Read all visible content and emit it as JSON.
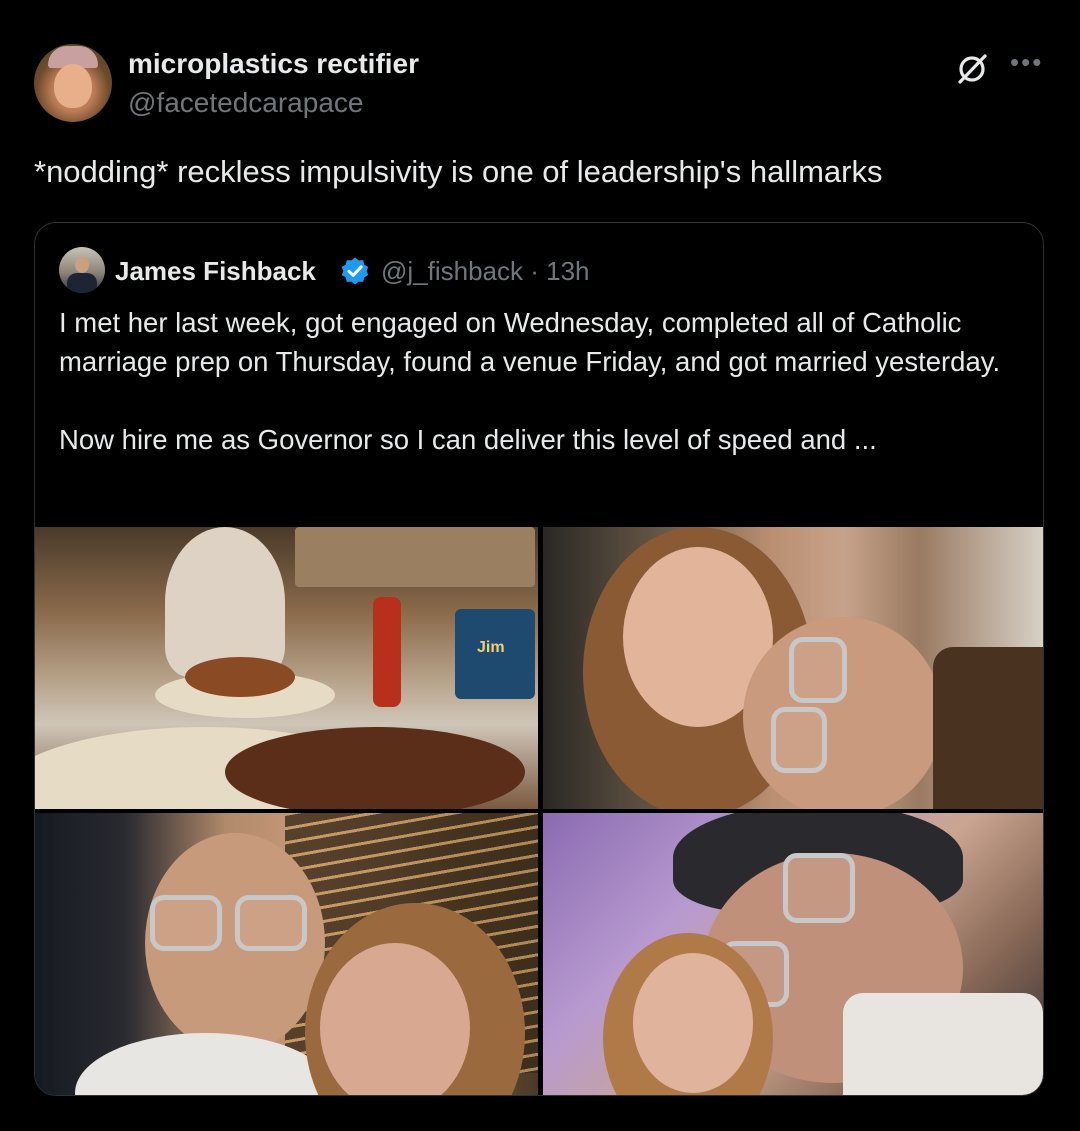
{
  "author": {
    "display_name": "microplastics rectifier",
    "handle": "@facetedcarapace"
  },
  "tweet": {
    "text": "*nodding*  reckless impulsivity is one of leadership's hallmarks"
  },
  "icons": {
    "grok": "grok-icon",
    "more": "more-icon",
    "verified": "verified-badge-icon"
  },
  "quote": {
    "display_name": "James Fishback",
    "handle_time": "@j_fishback · 13h",
    "text_line1": "I met her last week, got engaged on Wednesday, completed all of Catholic marriage prep on Thursday, found a venue Friday, and got married yesterday.",
    "text_line2": "Now hire me as Governor so I can deliver this level of speed and ...",
    "photos": [
      "Couple at a restaurant table with plates of chicken",
      "Close-up selfie of couple, woman smiling",
      "Selfie of couple at night in front of a hotel",
      "Selfie of couple on an airplane"
    ],
    "sign_text": "Jim"
  },
  "colors": {
    "background": "#000000",
    "text": "#e7e9ea",
    "muted": "#71767b",
    "border": "#2f3336",
    "verified": "#1d9bf0"
  }
}
